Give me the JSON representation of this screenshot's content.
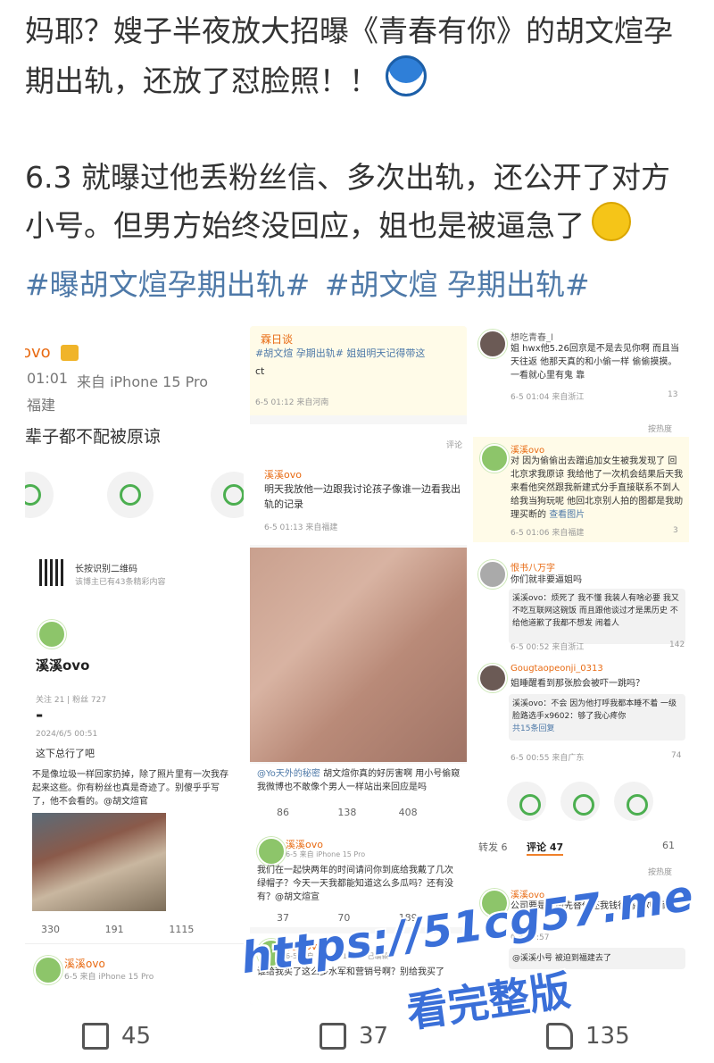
{
  "post": {
    "line1": "妈耶？嫂子半夜放大招曝《青春有你》的胡文煊孕期出轨，还放了怼脸照！！",
    "line2": "6.3 就曝过他丢粉丝信、多次出轨，还公开了对方小号。但男方始终没回应，姐也是被逼急了",
    "hashtags": [
      "#曝胡文煊孕期出轨#",
      "#胡文煊 孕期出轨#"
    ],
    "emoji1": "doraemon-emoji",
    "emoji2": "crying-laughing-emoji"
  },
  "panel1": {
    "username_tail": "ovo",
    "time": "01:01",
    "source": "来自 iPhone 15 Pro",
    "location": "福建",
    "text": "辈子都不配被原谅",
    "qr_text": "长按识别二维码",
    "qr_sub": "该博主已有43条精彩内容",
    "profile_name": "溪溪ovo",
    "follow_text": "关注 21 | 粉丝 727",
    "dash": "-",
    "date": "2024/6/5 00:51",
    "caption": "这下总行了吧",
    "body": "不是像垃圾一样回家扔掉，除了照片里有一次我存起来这些。你有粉丝也真是奇迹了。别傻乎乎写了，他不会看的。@胡文煊官",
    "counts": [
      "330",
      "191",
      "1115"
    ],
    "bottom_name": "溪溪ovo",
    "bottom_meta": "6-5 来自 iPhone 15 Pro"
  },
  "panel2": {
    "username": "霖日谈",
    "post_line": "#胡文煊 孕期出轨#  姐姐明天记得带这",
    "post_line2": "ct",
    "time1": "6-5 01:12 来自河南",
    "more": "评论",
    "c1_name": "溪溪ovo",
    "c1_text": "明天我放他一边跟我讨论孩子像谁一边看我出轨的记录",
    "c1_time": "6-5 01:13 来自福建",
    "reply_user": "@Yo天外的秘密",
    "reply_text": "胡文煊你真的好厉害啊 用小号偷窥我微博也不敢像个男人一样站出来回应是吗",
    "counts": [
      "86",
      "138",
      "408"
    ],
    "c2_name": "溪溪ovo",
    "c2_meta": "6-5 来自 iPhone 15 Pro",
    "c2_text": "我们在一起快两年的时间请问你到底给我戴了几次绿帽子？今天一天我都能知道这么多瓜吗？还有没有？@胡文煊宣",
    "counts2": [
      "37",
      "70",
      "189"
    ],
    "c3_name": "溪溪ovo",
    "c3_meta": "6-5 来自 iPhone 15 Pro 已编辑",
    "c3_text": "谁给我买了这么多水军和营销号啊？别给我买了"
  },
  "panel3": {
    "c1_name": "想吃青春_l",
    "c1_text": "姐 hwx他5.26回京是不是去见你啊 而且当天往返 他那天真的和小偷一样 偷偷摸摸。一看就心里有鬼 靠",
    "c1_time": "6-5 01:04 来自浙江",
    "c1_likes": "13",
    "sort": "按热度",
    "c2_name": "溪溪ovo",
    "c2_text": "对 因为偷偷出去蹭追加女生被我发现了 回北京求我原谅 我给他了一次机会结果后天我来看他突然跟我新建式分手直接联系不到人 给我当狗玩呢 他回北京别人拍的图都是我助理买断的",
    "c2_link": "查看图片",
    "c2_time": "6-5 01:06 来自福建",
    "c2_likes": "3",
    "c3_name": "恨书八万字",
    "c3_text": "你们就非要逼姐吗",
    "c3_reply": "溪溪ovo：烦死了 我不懂 我装人有啥必要 我又不吃互联网这碗饭 而且跟他谈过才是黑历史 不给他道歉了我都不想发 闹着人",
    "c3_time": "6-5 00:52 来自浙江",
    "c3_likes": "142",
    "c4_name": "Gougtaopeonji_0313",
    "c4_text": "姐睡醒看到那张脸会被吓一跳吗？",
    "c4_reply": "溪溪ovo：不会 因为他打呼我都本睡不着 一级脸路选手x9602：够了我心疼你",
    "c4_more": "共15条回复",
    "c4_time": "6-5 00:55 来自广东",
    "c4_likes": "74",
    "tabs": [
      "转发 6",
      "评论 47",
      "61"
    ],
    "c5_name": "溪溪ovo",
    "c5_text": "公司要是护他先替他还我钱行吗@刘宁耐片人",
    "c5_meta": "6-4 23:57",
    "c6_text": "@溪溪小号 被迫到福建去了"
  },
  "bottom": {
    "share": "45",
    "comment": "37",
    "like": "135"
  },
  "watermark": {
    "url": "https://51cg57.me",
    "text": "看完整版"
  }
}
